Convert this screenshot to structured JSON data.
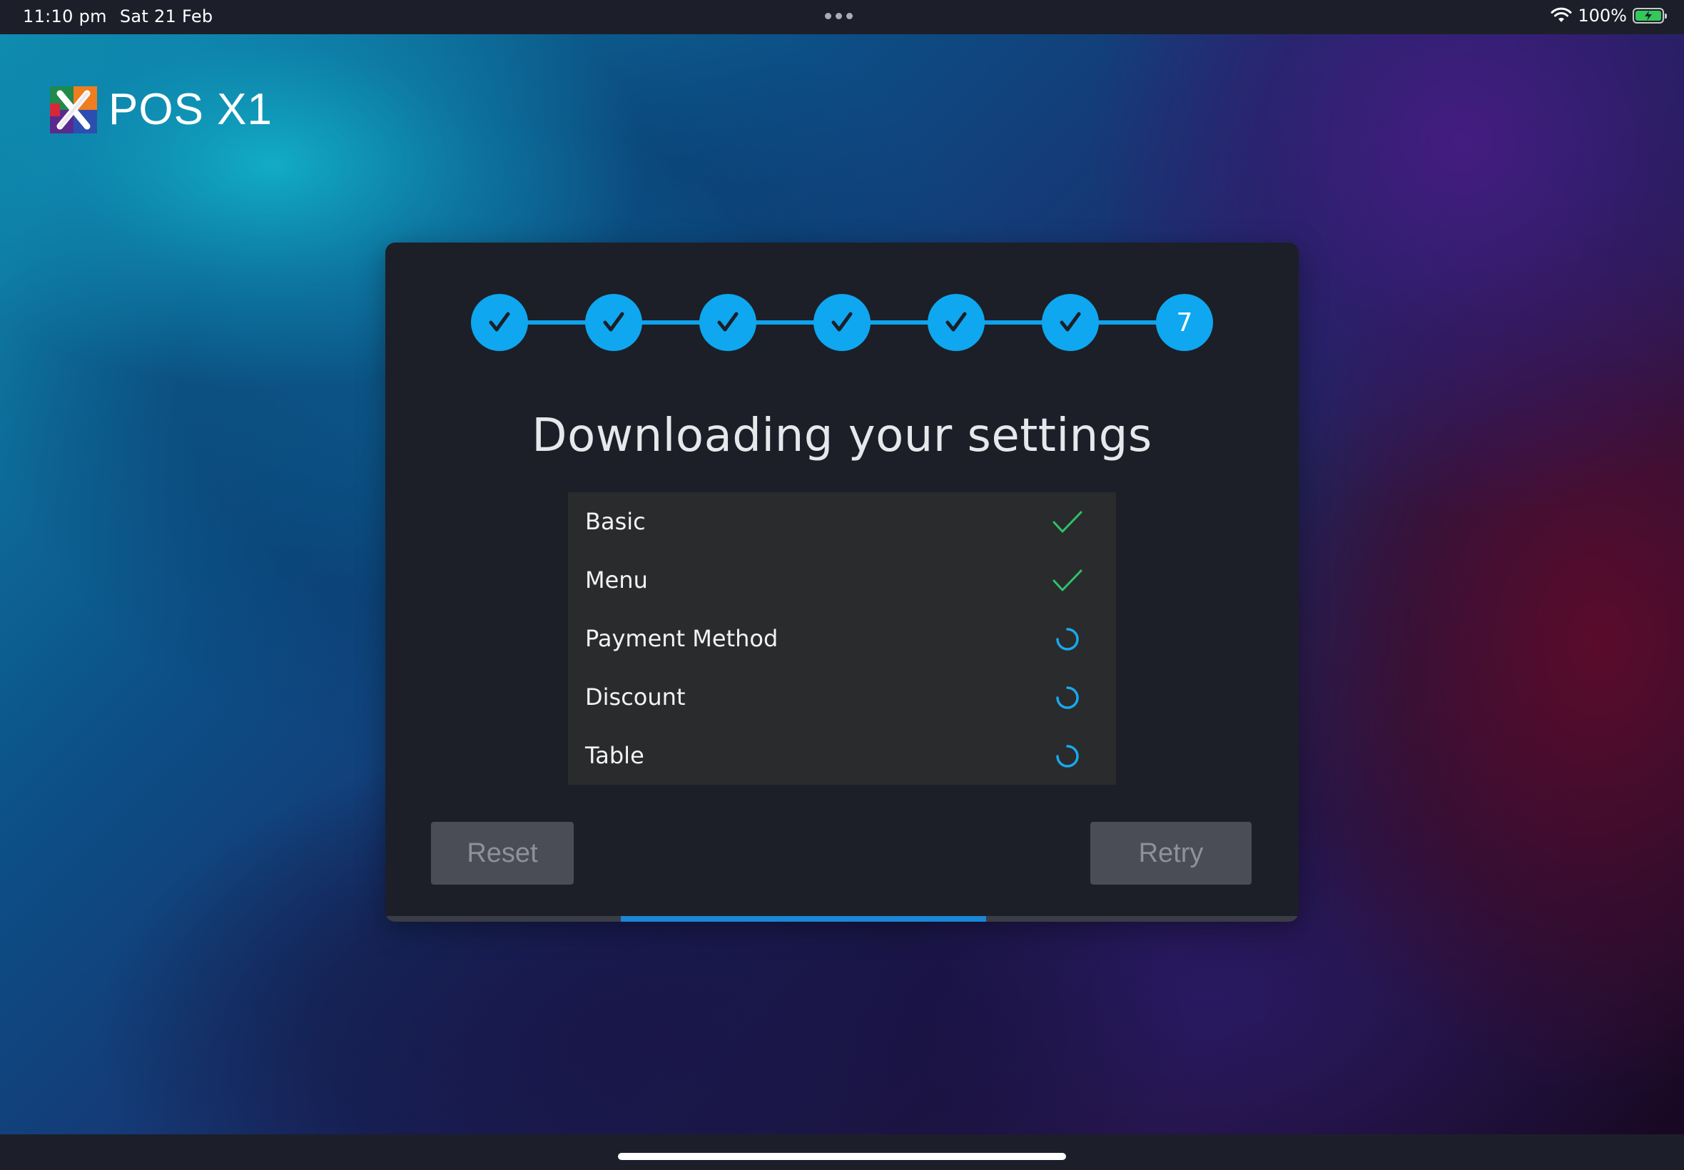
{
  "status_bar": {
    "time": "11:10 pm",
    "date": "Sat 21 Feb",
    "battery_percent": "100%",
    "battery_level": 1.0,
    "icons": [
      "wifi-icon",
      "battery-charging-icon"
    ]
  },
  "app": {
    "name": "POS X1"
  },
  "stepper": {
    "current_step_label": "7",
    "completed_steps": 6,
    "total_steps": 7,
    "color": "#0ea7f0"
  },
  "dialog": {
    "title": "Downloading your settings",
    "items": [
      {
        "label": "Basic",
        "status": "done"
      },
      {
        "label": "Menu",
        "status": "done"
      },
      {
        "label": "Payment Method",
        "status": "loading"
      },
      {
        "label": "Discount",
        "status": "loading"
      },
      {
        "label": "Table",
        "status": "loading"
      }
    ],
    "reset_label": "Reset",
    "retry_label": "Retry"
  },
  "colors": {
    "accent": "#0ea7f0",
    "success": "#2ec26b",
    "spinner": "#19a8ee",
    "dialog_bg": "#1c1f27",
    "button_bg": "#4a4d55"
  }
}
